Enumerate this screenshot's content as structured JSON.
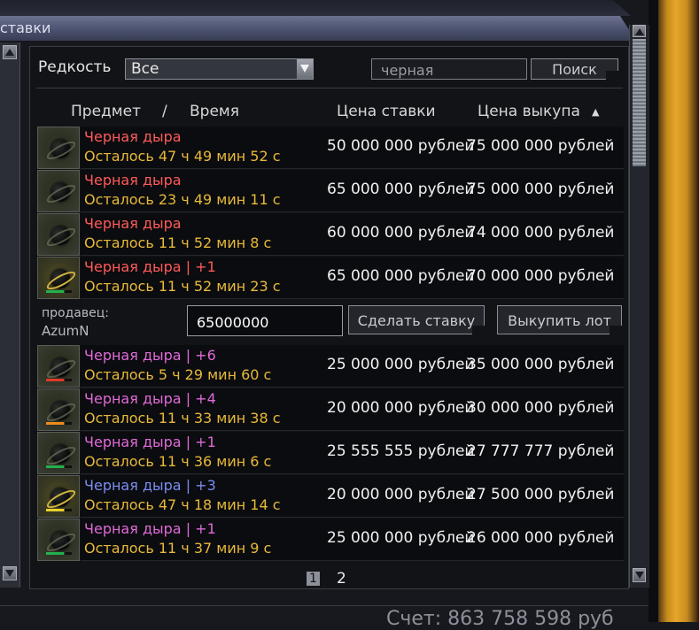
{
  "window": {
    "title": "ставки"
  },
  "filters": {
    "rarity_label": "Редкость",
    "rarity_value": "Все",
    "search_value": "черная",
    "search_button": "Поиск"
  },
  "columns": {
    "item": "Предмет",
    "separator": "/",
    "time": "Время",
    "bid": "Цена ставки",
    "buyout": "Цена выкупа",
    "sort_icon": "▲"
  },
  "lots": [
    {
      "name": "Черная дыра",
      "time": "Осталось 47 ч 49 мин 52 с",
      "bid": "50 000 000 рублей",
      "buyout": "75 000 000 рублей",
      "name_color": "#ff5a5a",
      "level_color": ""
    },
    {
      "name": "Черная дыра",
      "time": "Осталось 23 ч 49 мин 11 с",
      "bid": "65 000 000 рублей",
      "buyout": "75 000 000 рублей",
      "name_color": "#ff5a5a",
      "level_color": ""
    },
    {
      "name": "Черная дыра",
      "time": "Осталось 11 ч 52 мин 8 с",
      "bid": "60 000 000 рублей",
      "buyout": "74 000 000 рублей",
      "name_color": "#ff5a5a",
      "level_color": ""
    },
    {
      "name": "Черная дыра | +1",
      "time": "Осталось 11 ч 52 мин 23 с",
      "bid": "65 000 000 рублей",
      "buyout": "70 000 000 рублей",
      "name_color": "#ff5a5a",
      "level_color": "#22b14c"
    },
    {
      "name": "Черная дыра | +6",
      "time": "Осталось 5 ч 29 мин 60 с",
      "bid": "25 000 000 рублей",
      "buyout": "35 000 000 рублей",
      "name_color": "#e06ad8",
      "level_color": "#e03a2a"
    },
    {
      "name": "Черная дыра | +4",
      "time": "Осталось 11 ч 33 мин 38 с",
      "bid": "20 000 000 рублей",
      "buyout": "30 000 000 рублей",
      "name_color": "#e06ad8",
      "level_color": "#f08a1c"
    },
    {
      "name": "Черная дыра | +1",
      "time": "Осталось 11 ч 36 мин 6 с",
      "bid": "25 555 555 рублей",
      "buyout": "27 777 777 рублей",
      "name_color": "#e06ad8",
      "level_color": "#22b14c"
    },
    {
      "name": "Черная дыра | +3",
      "time": "Осталось 47 ч 18 мин 14 с",
      "bid": "20 000 000 рублей",
      "buyout": "27 500 000 рублей",
      "name_color": "#7b8df0",
      "level_color": "#e8d22a"
    },
    {
      "name": "Черная дыра | +1",
      "time": "Осталось 11 ч 37 мин 9 с",
      "bid": "25 000 000 рублей",
      "buyout": "26 000 000 рублей",
      "name_color": "#e06ad8",
      "level_color": "#22b14c"
    }
  ],
  "selected_lot": {
    "seller_label": "продавец:",
    "seller_name": "AzumN",
    "bid_value": "65000000",
    "bid_button": "Сделать ставку",
    "buyout_button": "Выкупить лот"
  },
  "pagination": {
    "current": "1",
    "next": "2"
  },
  "footer": {
    "balance": "Счет: 863 758 598 руб"
  }
}
